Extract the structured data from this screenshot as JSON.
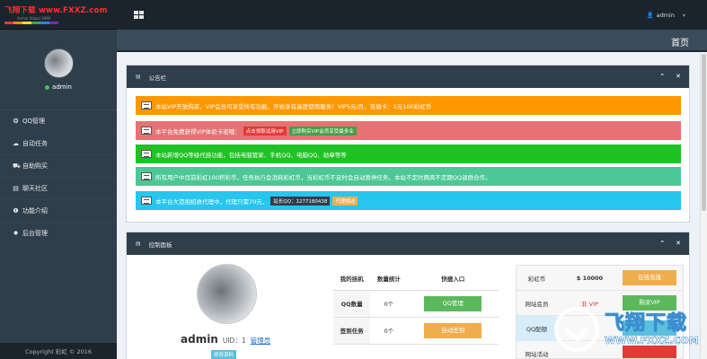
{
  "logo": {
    "main": "飞翔下载 www.FXXZ.com",
    "sub": "Xinhai Xiazai 1990",
    "bar_colors": [
      "#e53935",
      "#fb8c00",
      "#fdd835",
      "#43a047",
      "#1e88e5",
      "#8e24aa"
    ]
  },
  "sidebar": {
    "username": "admin",
    "items": [
      {
        "icon": "❂",
        "label": "QQ管理"
      },
      {
        "icon": "☁",
        "label": "自动任务"
      },
      {
        "icon": "⛟",
        "label": "自助购买"
      },
      {
        "icon": "▤",
        "label": "聊天社区"
      },
      {
        "icon": "❶",
        "label": "功能介绍"
      },
      {
        "icon": "✹",
        "label": "后台管理"
      }
    ],
    "copyright": "Copyright 彩虹 © 2016"
  },
  "topbar": {
    "user_icon": "👤",
    "user": "admin",
    "caret": "▾"
  },
  "pagebar": {
    "title": "首页"
  },
  "notice_panel": {
    "title": "公告栏",
    "collapse": "⌃",
    "close": "✕",
    "notices": [
      {
        "text": "本站VIP开放购买，VIP会员可享受所有功能，开始享有高度使用服务！VIP5元/月，充值卡：1元100彩虹币",
        "bg": "#ff9800",
        "tags": []
      },
      {
        "text": "本平台免费获得VIP体验卡密哦：",
        "bg": "#e57373",
        "tags": [
          {
            "label": "点击领取试用VIP",
            "bg": "#e53935"
          },
          {
            "label": "立即购买VIP会员享受最多业",
            "bg": "#43a047"
          }
        ]
      },
      {
        "text": "本站新增QQ等级代挂功能，包括电脑管家、手机QQ、电脑QQ、勋章等等",
        "bg": "#1ec323",
        "tags": []
      },
      {
        "text": "所有用户中目前彩虹100积彩币，任务执行会消耗彩虹币，当彩虹币不足时会自动暂停任务。本站不定时两周不定期QQ退群合作。",
        "bg": "#4cc795",
        "tags": []
      },
      {
        "text": "本平台大范围招收代理中，代理只需70元，",
        "bg": "#26c6ef",
        "tags": [
          {
            "label": "站长QQ：1277180438",
            "bg": "#2f3e4b"
          },
          {
            "label": "代理描述",
            "bg": "#f0ad4e"
          }
        ]
      }
    ]
  },
  "control_panel": {
    "title": "控制面板",
    "collapse": "⌃",
    "close": "✕",
    "profile_name": "admin",
    "uid_text": "UID：1",
    "role_link": "管理员",
    "edit_button": "修改资料",
    "table_headers": [
      "我的挂机",
      "数量统计",
      "快捷入口"
    ],
    "table_rows": [
      {
        "label": "QQ数量",
        "count": "0个",
        "action": "QQ管理",
        "action_color": "#5cb85c"
      },
      {
        "label": "签到任务",
        "count": "0个",
        "action": "自动签到",
        "action_color": "#f0ad4e"
      }
    ],
    "info_rows": [
      {
        "label": "彩虹币",
        "value": "$ 10000",
        "value_color": "#333333",
        "action": "在线充值",
        "action_color": "#f0ad4e"
      },
      {
        "label": "网站会员",
        "value": "非 VIP",
        "value_color": "#e53935",
        "action": "购买VIP",
        "action_color": "#5cb85c"
      },
      {
        "label": "QQ配额",
        "value": "",
        "value_color": "#333333",
        "action": "",
        "action_color": "#5bc0de"
      },
      {
        "label": "网站活动",
        "value": "",
        "value_color": "#333333",
        "action": "",
        "action_color": "#e53935"
      }
    ]
  },
  "watermark": {
    "title": "飞翔下载",
    "url": "WWW.FXXZ.COM"
  }
}
